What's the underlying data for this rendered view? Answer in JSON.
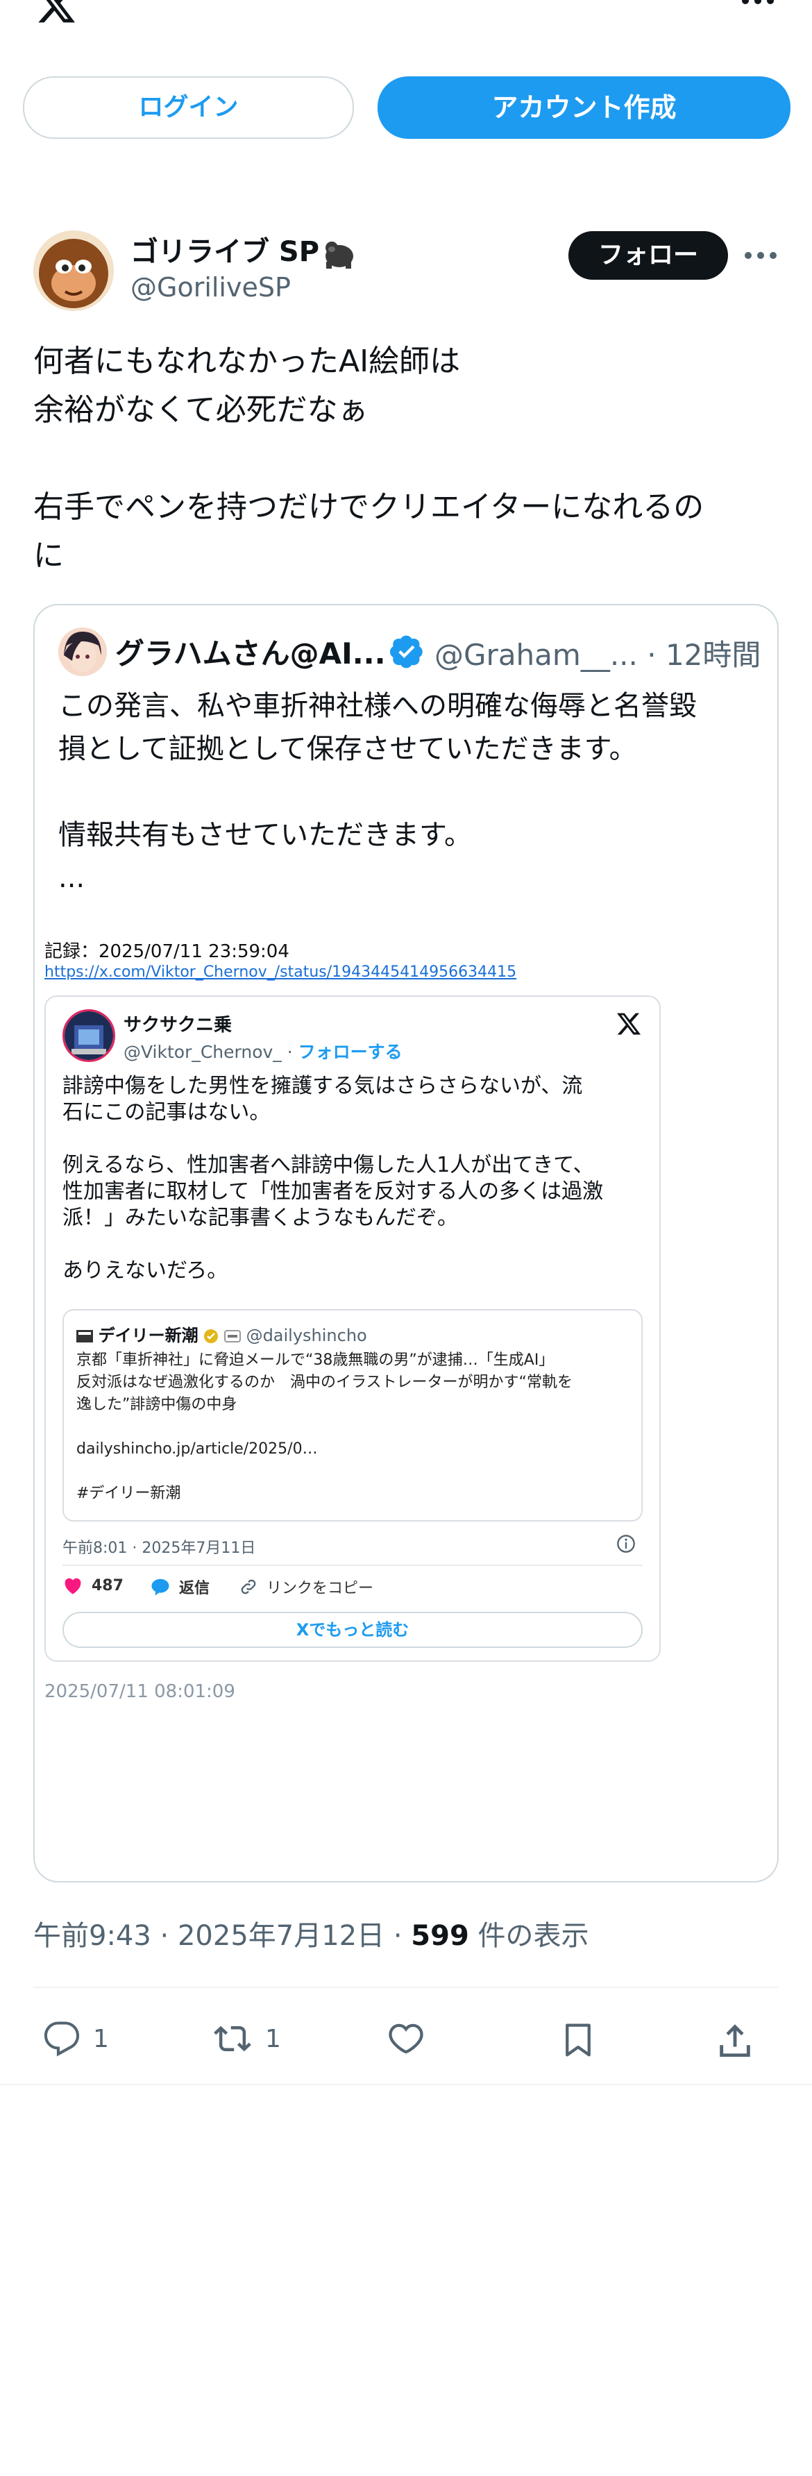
{
  "header": {
    "logo_icon": "x-logo-icon",
    "more_icon": "more-horizontal-icon"
  },
  "auth": {
    "login_label": "ログイン",
    "signup_label": "アカウント作成"
  },
  "tweet": {
    "author_name": "ゴリライブ SP",
    "author_emoji": "gorilla-icon",
    "author_handle": "@GoriliveSP",
    "follow_label": "フォロー",
    "text": "何者にもなれなかったAI絵師は\n余裕がなくて必死だなぁ\n\n右手でペンを持つだけでクリエイターになれるの\nに",
    "time": "午前9:43",
    "date": "2025年7月12日",
    "view_count": "599",
    "view_label": "件の表示",
    "separator": "·",
    "replies": "1",
    "reposts": "1"
  },
  "quoted": {
    "name": "グラハムさん@AI...",
    "handle": "@Graham__...",
    "time": "12時間",
    "text": "この発言、私や車折神社様への明確な侮辱と名誉毀\n損として証拠として保存させていただきます。\n\n情報共有もさせていただきます。\n...",
    "record_label": "記録：2025/07/11 23:59:04",
    "record_link": "https://x.com/Viktor_Chernov_/status/1943445414956634415",
    "embed": {
      "name": "サクサクニ乗",
      "handle": "@Viktor_Chernov_",
      "follow_label": "フォローする",
      "text": "誹謗中傷をした男性を擁護する気はさらさらないが、流\n石にこの記事はない。\n\n例えるなら、性加害者へ誹謗中傷した人1人が出てきて、\n性加害者に取材して「性加害者を反対する人の多くは過激\n派！」みたいな記事書くようなもんだぞ。\n\nありえないだろ。",
      "news": {
        "name": "デイリー新潮",
        "handle": "@dailyshincho",
        "text": "京都「車折神社」に脅迫メールで“38歳無職の男”が逮捕…「生成AI」\n反対派はなぜ過激化するのか　渦中のイラストレーターが明かす“常軌を\n逸した”誹謗中傷の中身\n\ndailyshincho.jp/article/2025/0…\n\n#デイリー新潮"
      },
      "date": "午前8:01 · 2025年7月11日",
      "likes": "487",
      "reply_label": "返信",
      "copy_link_label": "リンクをコピー",
      "read_more_label": "Xでもっと読む"
    },
    "captured_time": "2025/07/11 08:01:09"
  },
  "colors": {
    "accent": "#1d9bf0",
    "text": "#0f1419",
    "muted": "#536471",
    "border": "#cfd9de",
    "like": "#f91880"
  }
}
